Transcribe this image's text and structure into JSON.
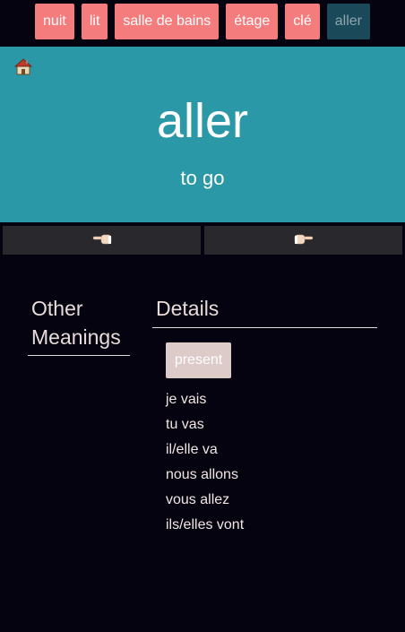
{
  "nav_tabs": [
    {
      "label": "nuit"
    },
    {
      "label": "lit"
    },
    {
      "label": "salle de bains"
    },
    {
      "label": "étage"
    },
    {
      "label": "clé"
    },
    {
      "label": "aller"
    }
  ],
  "card": {
    "home_icon": "house-icon",
    "word": "aller",
    "translation": "to go"
  },
  "navigation": {
    "prev_icon": "hand-pointing-left-icon",
    "next_icon": "hand-pointing-right-icon"
  },
  "other_meanings": {
    "heading": "Other Meanings"
  },
  "details": {
    "heading": "Details",
    "tense_label": "present",
    "conjugations": [
      "je vais",
      "tu vas",
      "il/elle va",
      "nous allons",
      "vous allez",
      "ils/elles vont"
    ]
  },
  "colors": {
    "tab": "#f47c7c",
    "tab_active": "#1a4a5a",
    "hero": "#2a98a6",
    "background": "#04030f",
    "tense_button": "#dccbc9"
  }
}
